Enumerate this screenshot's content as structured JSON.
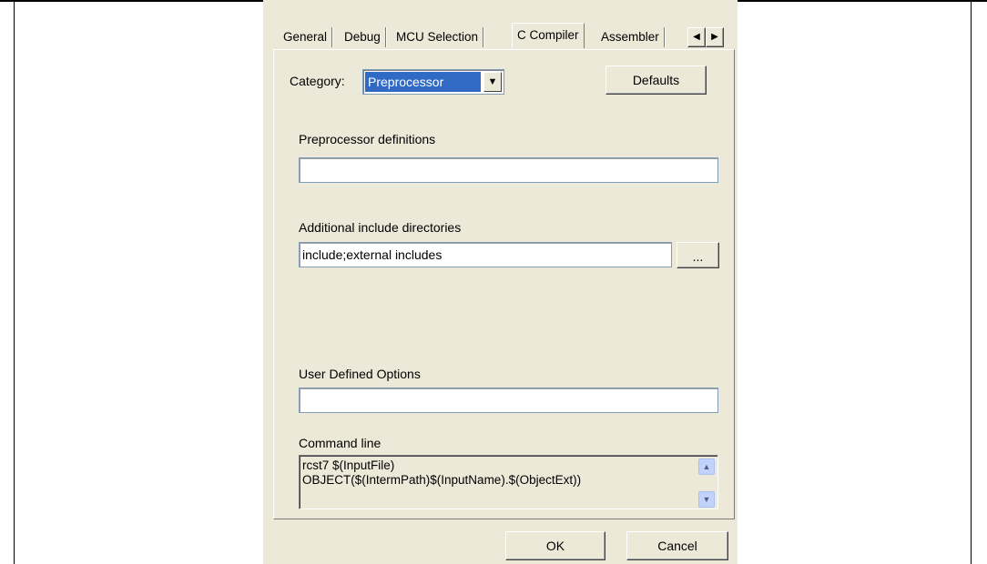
{
  "tabs": [
    {
      "label": "General",
      "selected": false
    },
    {
      "label": "Debug",
      "selected": false
    },
    {
      "label": "MCU Selection",
      "selected": false
    },
    {
      "label": "C Compiler",
      "selected": true
    },
    {
      "label": "Assembler",
      "selected": false
    }
  ],
  "tab_scroll": {
    "left_icon": "◀",
    "right_icon": "▶"
  },
  "category": {
    "label": "Category:",
    "selected": "Preprocessor",
    "arrow_icon": "▼"
  },
  "defaults_button": "Defaults",
  "preprocessor": {
    "label": "Preprocessor definitions",
    "value": ""
  },
  "include_dirs": {
    "label": "Additional include directories",
    "value": "include;external includes",
    "browse_label": "..."
  },
  "user_options": {
    "label": "User Defined Options",
    "value": ""
  },
  "command_line": {
    "label": "Command line",
    "lines": [
      "rcst7 $(InputFile)",
      "OBJECT($(IntermPath)$(InputName).$(ObjectExt))"
    ],
    "scroll_up_icon": "▲",
    "scroll_down_icon": "▼"
  },
  "ok_button": "OK",
  "cancel_button": "Cancel",
  "colors": {
    "dialog_bg": "#ece9d8",
    "selection": "#316ac5",
    "input_border": "#7f9db9"
  }
}
